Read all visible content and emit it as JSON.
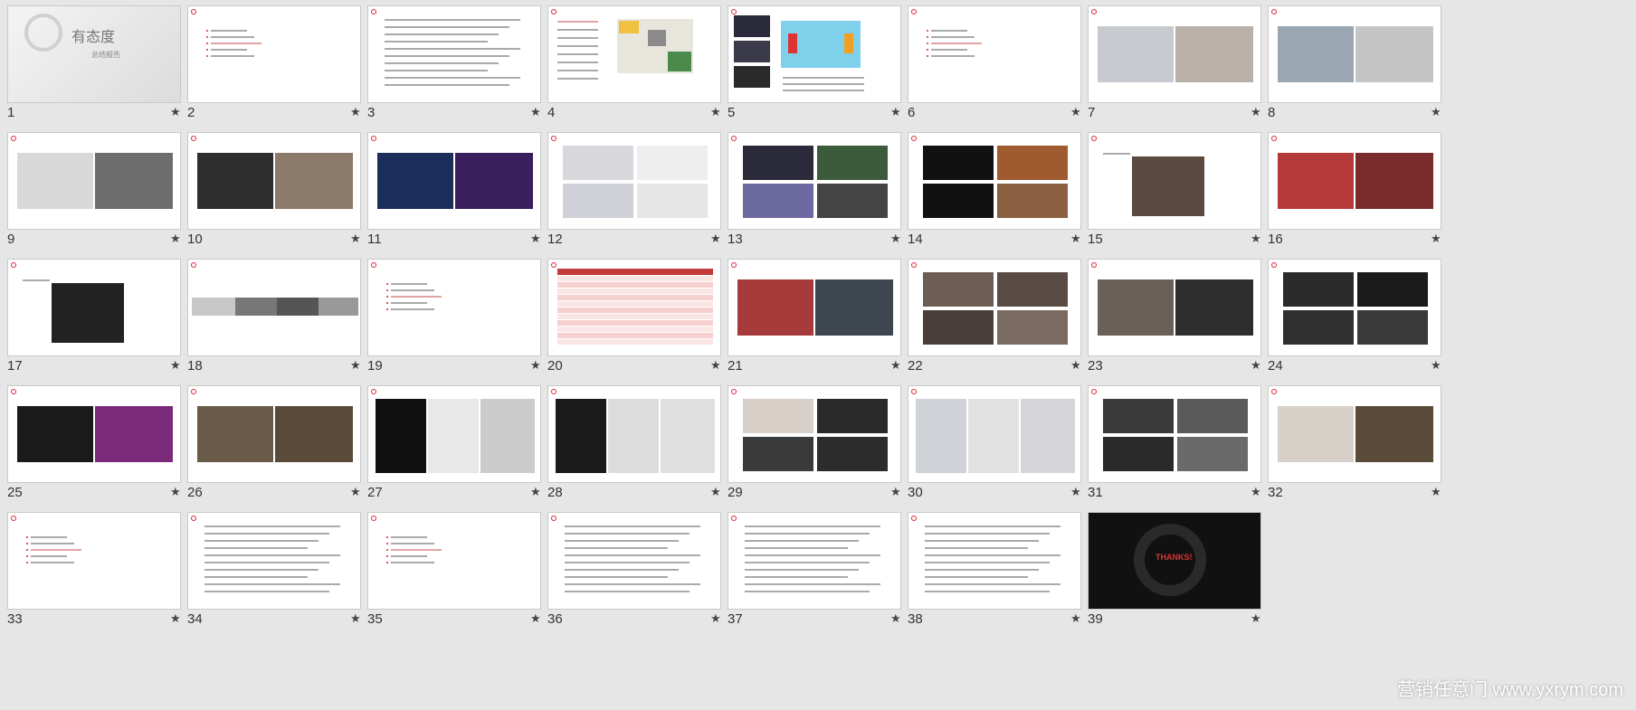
{
  "app": {
    "star_glyph": "★"
  },
  "slides": [
    {
      "n": "1",
      "kind": "cover",
      "cover_title": "有态度",
      "cover_sub": "总结报告"
    },
    {
      "n": "2",
      "kind": "agenda"
    },
    {
      "n": "3",
      "kind": "text"
    },
    {
      "n": "4",
      "kind": "map"
    },
    {
      "n": "5",
      "kind": "floorplan"
    },
    {
      "n": "6",
      "kind": "agenda"
    },
    {
      "n": "7",
      "kind": "photo2",
      "tones": [
        "#c7cbd0",
        "#b9b0a8"
      ]
    },
    {
      "n": "8",
      "kind": "photo2",
      "tones": [
        "#9aa7b3",
        "#c5c5c5"
      ]
    },
    {
      "n": "9",
      "kind": "photo2",
      "tones": [
        "#d8d8d8",
        "#6d6d6d"
      ]
    },
    {
      "n": "10",
      "kind": "photo2",
      "tones": [
        "#2e2e2e",
        "#8c7a6a"
      ]
    },
    {
      "n": "11",
      "kind": "photo2",
      "tones": [
        "#1b2d5a",
        "#3a1f5e"
      ]
    },
    {
      "n": "12",
      "kind": "photo4",
      "tones": [
        "#d8d8dc",
        "#eeeeee",
        "#d0d0d8",
        "#e6e6e6"
      ]
    },
    {
      "n": "13",
      "kind": "photo4",
      "tones": [
        "#2a2a3a",
        "#3b5b3b",
        "#6c6aa0",
        "#444"
      ]
    },
    {
      "n": "14",
      "kind": "photo4",
      "tones": [
        "#111",
        "#a05a30",
        "#111",
        "#8a6040"
      ]
    },
    {
      "n": "15",
      "kind": "photo1c",
      "tones": [
        "#5a4a3f"
      ]
    },
    {
      "n": "16",
      "kind": "photo2",
      "tones": [
        "#b43a3a",
        "#7a2b2b"
      ]
    },
    {
      "n": "17",
      "kind": "photo1c",
      "tones": [
        "#222"
      ]
    },
    {
      "n": "18",
      "kind": "strip",
      "tones": [
        "#c8c8c8",
        "#777",
        "#555",
        "#999"
      ]
    },
    {
      "n": "19",
      "kind": "agenda"
    },
    {
      "n": "20",
      "kind": "table"
    },
    {
      "n": "21",
      "kind": "photo2",
      "tones": [
        "#a63a3a",
        "#3e4650"
      ]
    },
    {
      "n": "22",
      "kind": "photo4",
      "tones": [
        "#6e5d55",
        "#5a4c44",
        "#4a3e3a",
        "#7a6a60"
      ]
    },
    {
      "n": "23",
      "kind": "photo2",
      "tones": [
        "#6a605a",
        "#2e2e2e"
      ]
    },
    {
      "n": "24",
      "kind": "photo4",
      "tones": [
        "#2b2b2b",
        "#1a1a1a",
        "#2f2f2f",
        "#3a3a3a"
      ]
    },
    {
      "n": "25",
      "kind": "photo2",
      "tones": [
        "#1a1a1a",
        "#7a2a7a"
      ]
    },
    {
      "n": "26",
      "kind": "photo2",
      "tones": [
        "#6a5a4a",
        "#5a4a3a"
      ]
    },
    {
      "n": "27",
      "kind": "photo3",
      "tones": [
        "#111",
        "#e8e8e8",
        "#ccc"
      ]
    },
    {
      "n": "28",
      "kind": "photo3",
      "tones": [
        "#1a1a1a",
        "#dcdcdc",
        "#e0e0e0"
      ]
    },
    {
      "n": "29",
      "kind": "photo4",
      "tones": [
        "#d8d0c8",
        "#2a2a2a",
        "#3a3a3a",
        "#2c2c2c"
      ]
    },
    {
      "n": "30",
      "kind": "photo3",
      "tones": [
        "#cfd2d6",
        "#e1e1e1",
        "#d5d5d8"
      ]
    },
    {
      "n": "31",
      "kind": "photo4",
      "tones": [
        "#3a3a3a",
        "#5a5a5a",
        "#2a2a2a",
        "#6a6a6a"
      ]
    },
    {
      "n": "32",
      "kind": "photo2",
      "tones": [
        "#d6d0c8",
        "#5a4a3a"
      ]
    },
    {
      "n": "33",
      "kind": "agenda"
    },
    {
      "n": "34",
      "kind": "text"
    },
    {
      "n": "35",
      "kind": "agenda"
    },
    {
      "n": "36",
      "kind": "text"
    },
    {
      "n": "37",
      "kind": "text"
    },
    {
      "n": "38",
      "kind": "text"
    },
    {
      "n": "39",
      "kind": "thanks",
      "thanks_text": "THANKS!"
    }
  ],
  "watermark": "营销任意门 www.yxrym.com"
}
